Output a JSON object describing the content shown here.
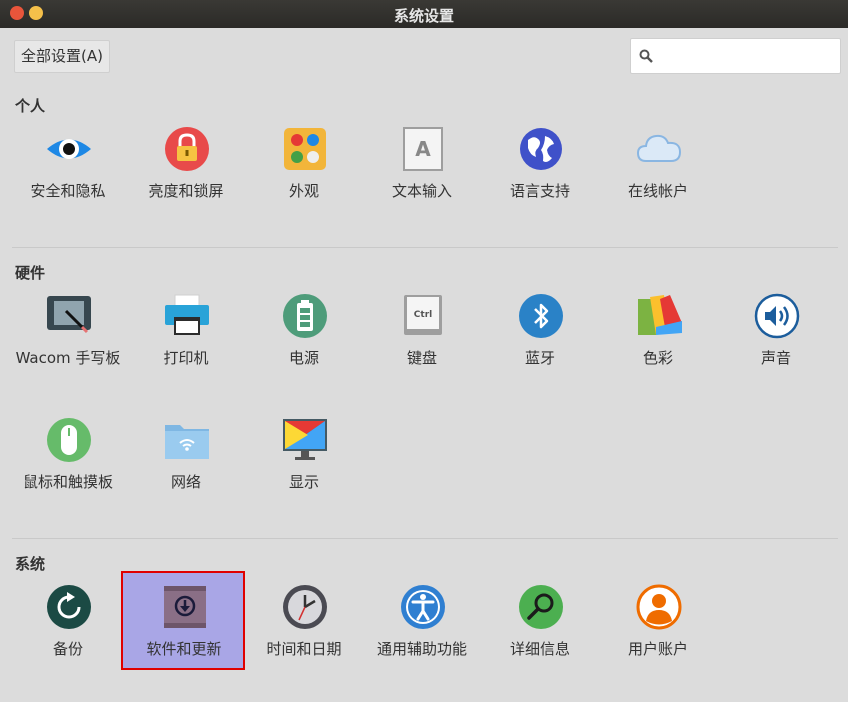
{
  "window": {
    "title": "系统设置"
  },
  "toolbar": {
    "all_settings_label": "全部设置(A)",
    "search_placeholder": ""
  },
  "sections": {
    "personal": {
      "title": "个人",
      "items": [
        "安全和隐私",
        "亮度和锁屏",
        "外观",
        "文本输入",
        "语言支持",
        "在线帐户"
      ]
    },
    "hardware": {
      "title": "硬件",
      "items": [
        "Wacom 手写板",
        "打印机",
        "电源",
        "键盘",
        "蓝牙",
        "色彩",
        "声音",
        "鼠标和触摸板",
        "网络",
        "显示"
      ]
    },
    "system": {
      "title": "系统",
      "items": [
        "备份",
        "软件和更新",
        "时间和日期",
        "通用辅助功能",
        "详细信息",
        "用户账户"
      ]
    }
  },
  "keyboard_icon_text": "Ctrl",
  "text_input_icon_text": "A",
  "icons": {
    "personal": [
      "eye-icon",
      "lock-icon",
      "appearance-icon",
      "text-entry-icon",
      "globe-icon",
      "cloud-icon"
    ],
    "hardware": [
      "wacom-tablet-icon",
      "printer-icon",
      "battery-icon",
      "keyboard-icon",
      "bluetooth-icon",
      "color-icon",
      "sound-icon",
      "mouse-icon",
      "network-folder-icon",
      "display-icon"
    ],
    "system": [
      "backup-icon",
      "software-update-icon",
      "clock-icon",
      "accessibility-icon",
      "details-icon",
      "user-icon"
    ]
  },
  "highlight_color": "#e00000"
}
